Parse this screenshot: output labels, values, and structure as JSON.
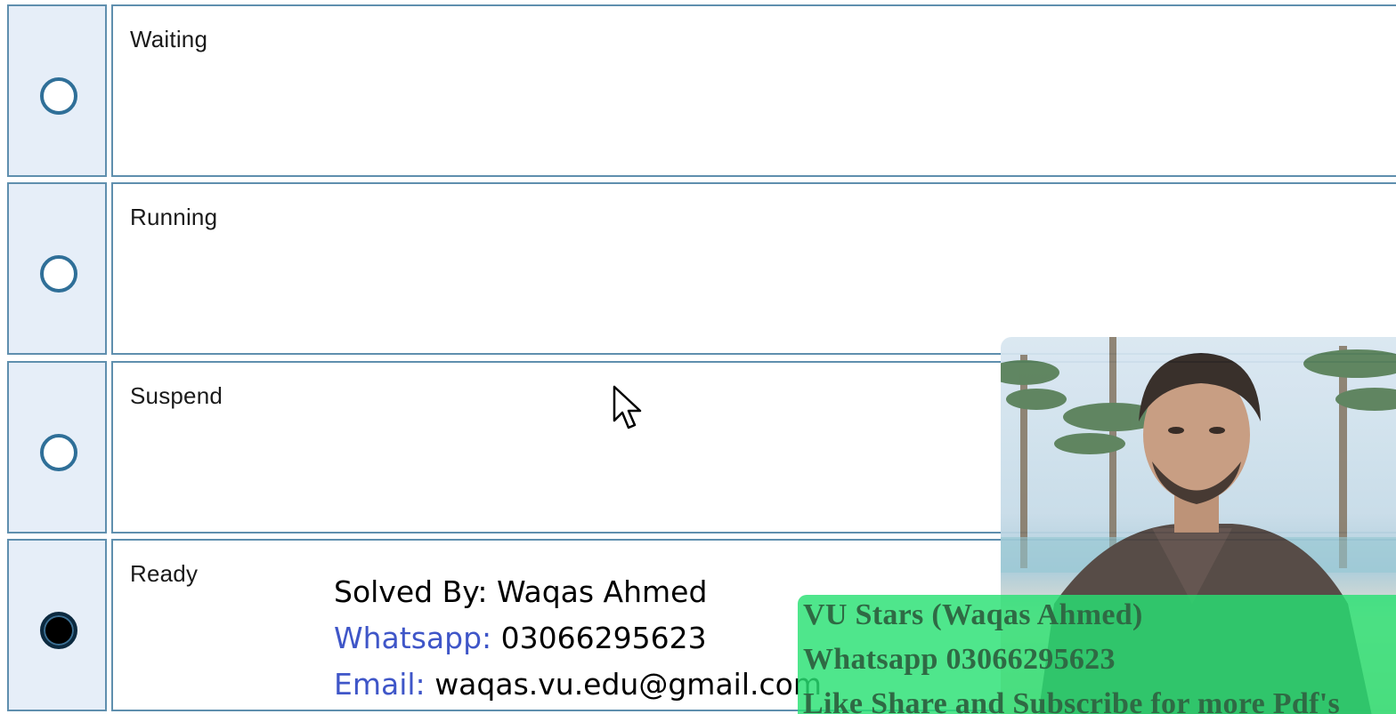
{
  "options": [
    {
      "label": "Waiting",
      "selected": false
    },
    {
      "label": "Running",
      "selected": false
    },
    {
      "label": "Suspend",
      "selected": false
    },
    {
      "label": "Ready",
      "selected": true
    }
  ],
  "solver": {
    "line1": "Solved By: Waqas Ahmed",
    "whatsapp_key": "Whatsapp:",
    "whatsapp_value": "03066295623",
    "email_key": "Email:",
    "email_value": "waqas.vu.edu@gmail.com"
  },
  "banner": {
    "line1": "VU Stars (Waqas Ahmed)",
    "line2": "Whatsapp 03066295623",
    "line3": "Like Share and Subscribe for more Pdf's"
  },
  "colors": {
    "radio_border": "#2f6f98",
    "cell_border": "#5f8fae",
    "radio_cell_bg": "#e6eef8",
    "solver_key": "#3f56c8",
    "banner_bg": "#28e173"
  }
}
